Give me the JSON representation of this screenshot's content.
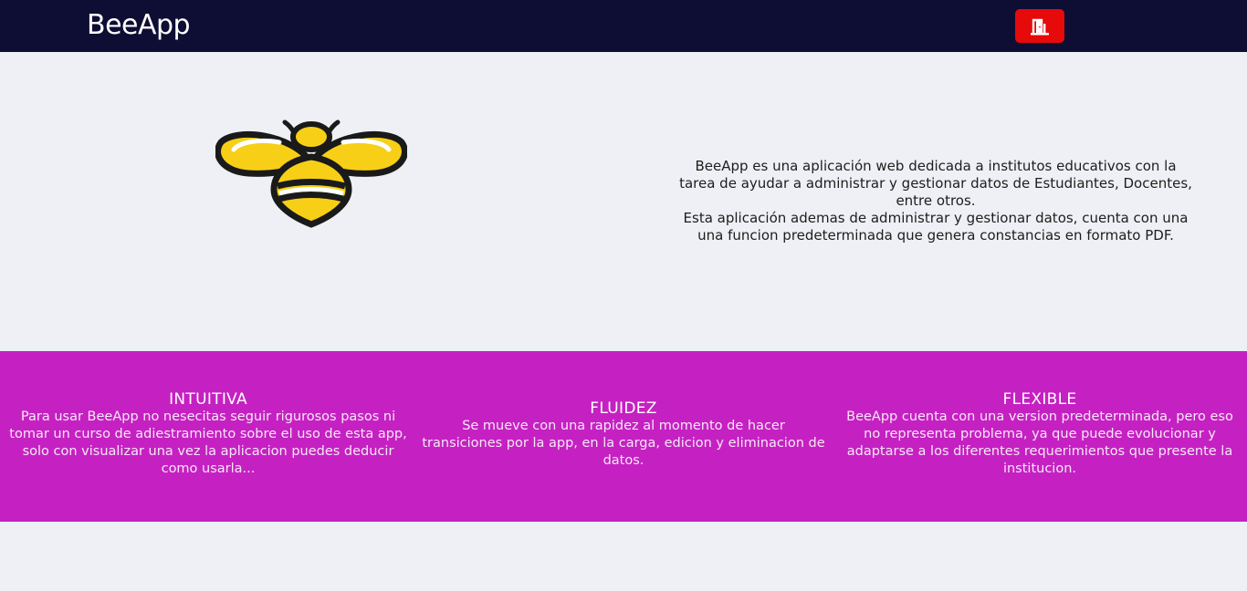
{
  "header": {
    "brand": "BeeApp",
    "logout_icon": "door-exit-icon",
    "logout_color": "#e60a0a",
    "background": "#0e0d33"
  },
  "hero": {
    "logo_icon": "bee-icon",
    "description_line1": "BeeApp es una aplicación web dedicada a institutos educativos con la tarea de ayudar a administrar y gestionar datos de Estudiantes, Docentes, entre otros.",
    "description_line2": "Esta aplicación ademas de administrar y gestionar datos, cuenta con una una funcion predeterminada que genera constancias en formato PDF."
  },
  "features": {
    "background": "#c521c2",
    "items": [
      {
        "title": "INTUITIVA",
        "text": "Para usar BeeApp no nesecitas seguir rigurosos pasos ni tomar un curso de adiestramiento sobre el uso de esta app, solo con visualizar una vez la aplicacion puedes deducir como usarla..."
      },
      {
        "title": "FLUIDEZ",
        "text": "Se mueve con una rapidez al momento de hacer transiciones por la app, en la carga, edicion y eliminacion de datos."
      },
      {
        "title": "FLEXIBLE",
        "text": "BeeApp cuenta con una version predeterminada, pero eso no representa problema, ya que puede evolucionar y adaptarse a los diferentes requerimientos que presente la institucion."
      }
    ]
  }
}
